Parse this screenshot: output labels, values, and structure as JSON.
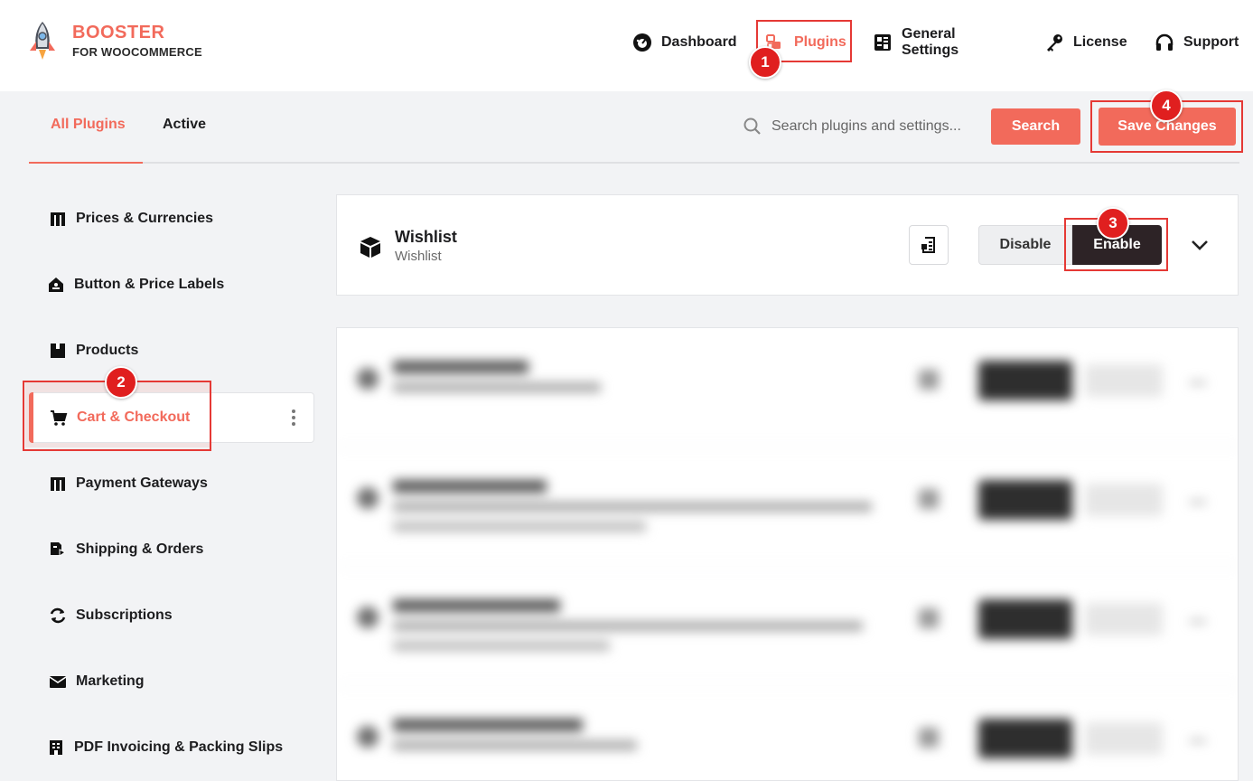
{
  "brand": {
    "line1": "BOOSTER",
    "line2": "FOR WOOCOMMERCE"
  },
  "nav": [
    {
      "label": "Dashboard",
      "icon": "dashboard-gauge-icon"
    },
    {
      "label": "Plugins",
      "icon": "plugins-cubes-icon",
      "active": true
    },
    {
      "label": "General Settings",
      "icon": "settings-grid-icon"
    },
    {
      "label": "License",
      "icon": "key-icon"
    },
    {
      "label": "Support",
      "icon": "headphones-icon"
    }
  ],
  "tabs": [
    {
      "label": "All Plugins",
      "active": true
    },
    {
      "label": "Active"
    }
  ],
  "search": {
    "placeholder": "Search plugins and settings...",
    "button_label": "Search"
  },
  "save_label": "Save Changes",
  "sidebar": [
    {
      "label": "Prices & Currencies",
      "icon": "pricetag-icon"
    },
    {
      "label": "Button & Price Labels",
      "icon": "label-icon"
    },
    {
      "label": "Products",
      "icon": "box-icon"
    },
    {
      "label": "Cart & Checkout",
      "icon": "cart-icon",
      "active": true
    },
    {
      "label": "Payment Gateways",
      "icon": "payment-icon"
    },
    {
      "label": "Shipping & Orders",
      "icon": "shipping-icon"
    },
    {
      "label": "Subscriptions",
      "icon": "refresh-icon"
    },
    {
      "label": "Marketing",
      "icon": "mail-icon"
    },
    {
      "label": "PDF Invoicing & Packing Slips",
      "icon": "invoice-icon"
    }
  ],
  "plugin": {
    "title": "Wishlist",
    "subtitle": "Wishlist",
    "disable_label": "Disable",
    "enable_label": "Enable"
  },
  "annotations": [
    "1",
    "2",
    "3",
    "4"
  ],
  "colors": {
    "accent": "#f26a5b",
    "dark": "#2d2326",
    "annotation": "#e01f1f"
  }
}
